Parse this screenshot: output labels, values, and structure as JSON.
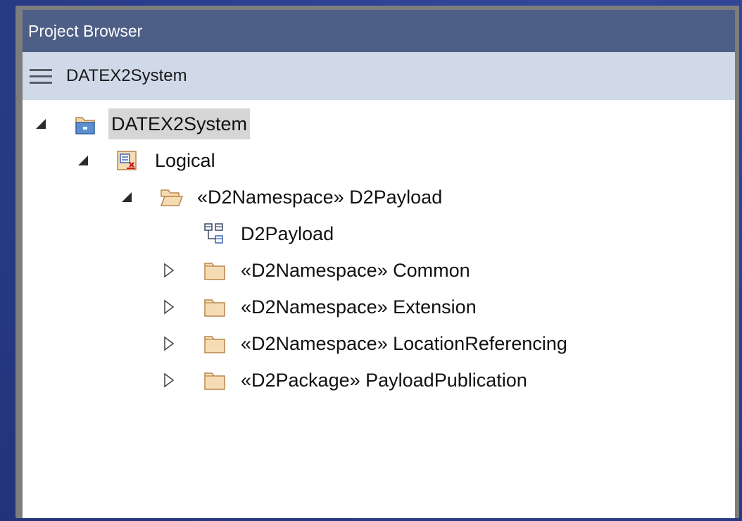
{
  "panel": {
    "title": "Project Browser"
  },
  "toolbar": {
    "menu_icon": "hamburger-menu-icon",
    "label": "DATEX2System"
  },
  "tree": {
    "items": [
      {
        "label": "DATEX2System",
        "icon": "model-root-icon",
        "state": "expanded",
        "selected": true
      },
      {
        "label": "Logical",
        "icon": "view-package-icon",
        "state": "expanded"
      },
      {
        "label": "«D2Namespace» D2Payload",
        "icon": "folder-open-icon",
        "state": "expanded"
      },
      {
        "label": "D2Payload",
        "icon": "class-diagram-icon",
        "state": "none"
      },
      {
        "label": "«D2Namespace» Common",
        "icon": "folder-icon",
        "state": "collapsed"
      },
      {
        "label": "«D2Namespace» Extension",
        "icon": "folder-icon",
        "state": "collapsed"
      },
      {
        "label": "«D2Namespace» LocationReferencing",
        "icon": "folder-icon",
        "state": "collapsed"
      },
      {
        "label": "«D2Package» PayloadPublication",
        "icon": "folder-icon",
        "state": "collapsed"
      }
    ]
  },
  "colors": {
    "titlebar": "#4d5f86",
    "toolbar": "#cfd9e8",
    "folder_fill": "#f6dcb4",
    "folder_stroke": "#b8864a",
    "selection": "#d6d6d6"
  }
}
